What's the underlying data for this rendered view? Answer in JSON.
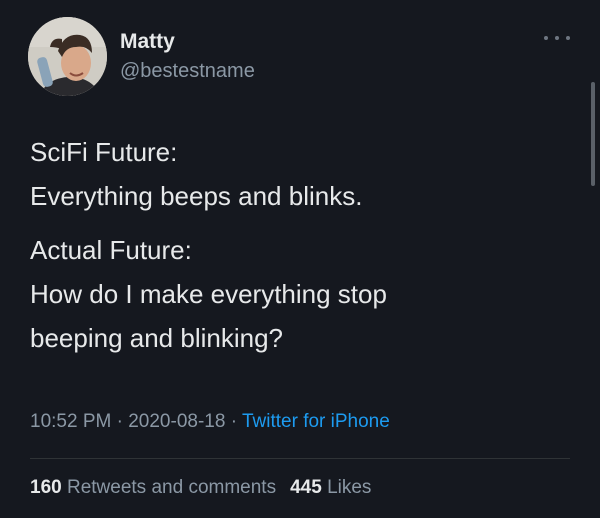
{
  "tweet": {
    "author": {
      "display_name": "Matty",
      "handle": "@bestestname",
      "avatar": "avatar-photo"
    },
    "body": {
      "paragraph1": [
        "SciFi Future:",
        "Everything beeps and blinks."
      ],
      "paragraph2": [
        "Actual Future:",
        "How do I make everything stop",
        "beeping and blinking?"
      ]
    },
    "meta": {
      "time": "10:52 PM",
      "separator": " · ",
      "date": "2020-08-18",
      "source": "Twitter for iPhone"
    },
    "stats": {
      "retweets_count": "160",
      "retweets_label": "Retweets and comments",
      "likes_count": "445",
      "likes_label": "Likes"
    },
    "more_icon": "more-horizontal-icon"
  },
  "colors": {
    "background": "#15181f",
    "text_primary": "#e7e9ea",
    "text_secondary": "#8b98a5",
    "link": "#1d9bf0",
    "divider": "#2f3336"
  }
}
